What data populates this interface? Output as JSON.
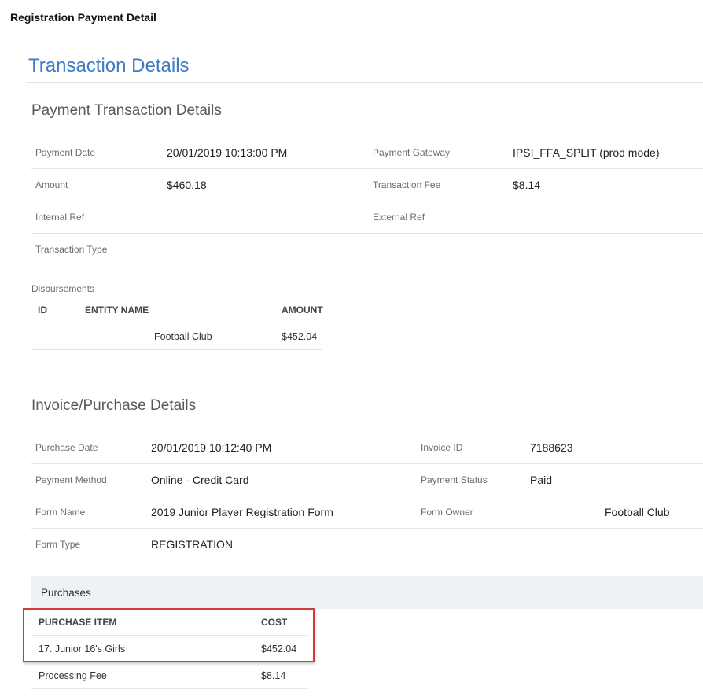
{
  "window_title": "Registration Payment Detail",
  "page_title": "Transaction Details",
  "payment": {
    "section_title": "Payment Transaction Details",
    "payment_date_label": "Payment Date",
    "payment_date": "20/01/2019 10:13:00 PM",
    "payment_gateway_label": "Payment Gateway",
    "payment_gateway": "IPSI_FFA_SPLIT (prod mode)",
    "amount_label": "Amount",
    "amount": "$460.18",
    "transaction_fee_label": "Transaction Fee",
    "transaction_fee": "$8.14",
    "internal_ref_label": "Internal Ref",
    "internal_ref": "",
    "external_ref_label": "External Ref",
    "external_ref": "",
    "transaction_type_label": "Transaction Type",
    "transaction_type": ""
  },
  "disbursements": {
    "label": "Disbursements",
    "headers": [
      "ID",
      "ENTITY NAME",
      "AMOUNT"
    ],
    "rows": [
      {
        "id": "",
        "entity_name": "Football Club",
        "amount": "$452.04"
      }
    ]
  },
  "invoice": {
    "section_title": "Invoice/Purchase Details",
    "purchase_date_label": "Purchase Date",
    "purchase_date": "20/01/2019 10:12:40 PM",
    "invoice_id_label": "Invoice ID",
    "invoice_id": "7188623",
    "payment_method_label": "Payment Method",
    "payment_method": "Online - Credit Card",
    "payment_status_label": "Payment Status",
    "payment_status": "Paid",
    "form_name_label": "Form Name",
    "form_name": "2019 Junior Player Registration Form",
    "form_owner_label": "Form Owner",
    "form_owner": "Football Club",
    "form_type_label": "Form Type",
    "form_type": "REGISTRATION"
  },
  "purchases": {
    "label": "Purchases",
    "headers": [
      "PURCHASE ITEM",
      "COST"
    ],
    "rows": [
      {
        "item": "17. Junior 16's Girls",
        "cost": "$452.04"
      },
      {
        "item": "Processing Fee",
        "cost": "$8.14"
      }
    ],
    "highlight_color": "#d43a3a"
  }
}
